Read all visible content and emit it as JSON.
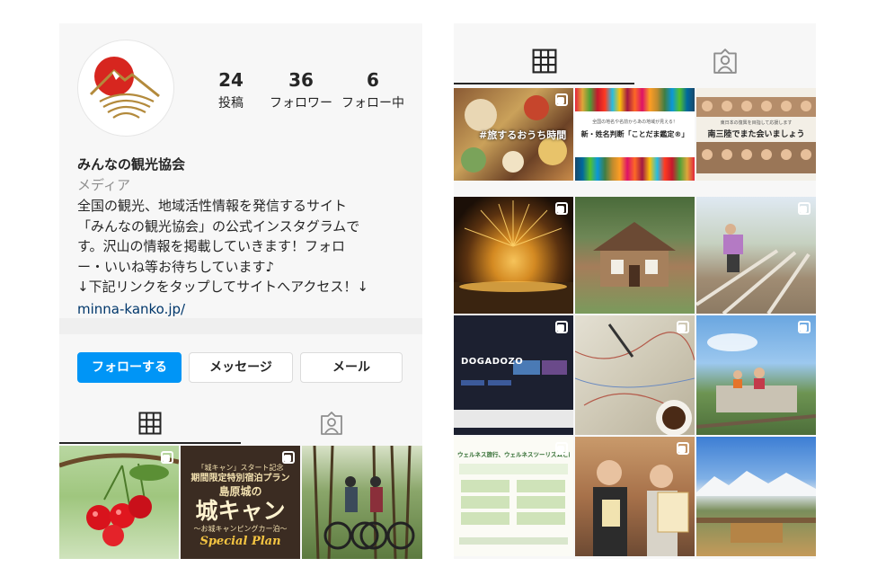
{
  "profile": {
    "posts_count": "24",
    "posts_label": "投稿",
    "followers_count": "36",
    "followers_label": "フォロワー",
    "following_count": "6",
    "following_label": "フォロー中",
    "name": "みんなの観光協会",
    "category": "メディア",
    "bio_lines": [
      "全国の観光、地域活性情報を発信するサイト",
      "「みんなの観光協会」の公式インスタグラムで",
      "す。沢山の情報を掲載していきます！フォロ",
      "ー・いいね等お待ちしています♪",
      "↓下記リンクをタップしてサイトへアクセス！↓"
    ],
    "link": "minna-kanko.jp/"
  },
  "actions": {
    "follow_label": "フォローする",
    "message_label": "メッセージ",
    "mail_label": "メール"
  },
  "tabs": [
    {
      "icon": "grid-icon",
      "active": true
    },
    {
      "icon": "tagged-person-icon",
      "active": false
    }
  ],
  "left_grid": [
    {
      "subject": "cherries",
      "multi": true
    },
    {
      "subject": "castle-camp-plan",
      "multi": true,
      "texts": {
        "top": "「城キャン」スタート記念",
        "mid": "期間限定特別宿泊プラン",
        "place": "島原城の",
        "big": "城キャン",
        "sub": "〜お城キャンピングカー泊〜",
        "plan": "Special Plan"
      }
    },
    {
      "subject": "forest-cyclists",
      "multi": false
    }
  ],
  "right_grid": [
    {
      "subject": "travel-home-time",
      "multi": true,
      "texts": {
        "caption": "#旅するおうち時間"
      }
    },
    {
      "subject": "sdgs-names",
      "multi": false,
      "texts": {
        "small": "全国の地名や名前からあの地域が見える！",
        "caption": "新・姓名判断「ことだま鑑定®」"
      }
    },
    {
      "subject": "sanriku-faces",
      "multi": false,
      "texts": {
        "small": "東日本の復興を目指して応援します",
        "caption": "南三陸でまた会いましょう"
      }
    },
    {
      "subject": "fireworks",
      "multi": true
    },
    {
      "subject": "log-house",
      "multi": false
    },
    {
      "subject": "farm-work",
      "multi": true
    },
    {
      "subject": "dogadozo-site",
      "multi": true,
      "texts": {
        "logo": "DOGADOZO"
      }
    },
    {
      "subject": "map-coffee",
      "multi": true
    },
    {
      "subject": "railway-bike",
      "multi": true
    },
    {
      "subject": "wellness-tourism",
      "multi": true,
      "texts": {
        "title": "ウェルネス旅行、ウェルネスツーリズムとは？"
      }
    },
    {
      "subject": "shop-owners",
      "multi": true
    },
    {
      "subject": "mountain-view",
      "multi": false
    }
  ],
  "colors": {
    "accent": "#0095f6",
    "link": "#00376b",
    "text": "#262626",
    "muted": "#8e8e8e"
  }
}
